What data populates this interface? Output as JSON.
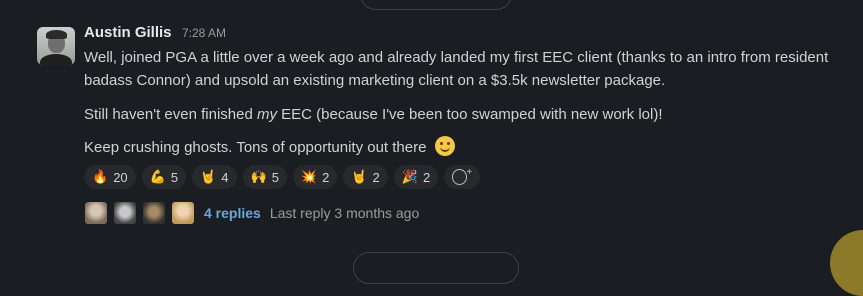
{
  "message": {
    "author": "Austin Gillis",
    "timestamp": "7:28 AM",
    "paragraphs": {
      "p1": "Well, joined PGA a little over a week ago and already landed my first EEC client (thanks to an intro from resident badass Connor) and upsold an existing marketing client on a $3.5k newsletter package.",
      "p2_before": "Still haven't even finished ",
      "p2_em": "my",
      "p2_after": " EEC (because I've been too swamped with new work lol)!",
      "p3": "Keep crushing ghosts. Tons of opportunity out there"
    },
    "inline_emoji": "slightly-smiling-face"
  },
  "reactions": [
    {
      "emoji": "🔥",
      "icon": "fire-emoji-icon",
      "count": "20"
    },
    {
      "emoji": "💪",
      "icon": "flexed-biceps-emoji-icon",
      "count": "5"
    },
    {
      "emoji": "🤘",
      "icon": "rock-on-emoji-icon",
      "count": "4"
    },
    {
      "emoji": "🙌",
      "icon": "raising-hands-emoji-icon",
      "count": "5"
    },
    {
      "emoji": "💥",
      "icon": "collision-emoji-icon",
      "count": "2"
    },
    {
      "emoji": "🤘",
      "icon": "rock-on-emoji-icon",
      "count": "2"
    },
    {
      "emoji": "🎉",
      "icon": "party-popper-emoji-icon",
      "count": "2"
    }
  ],
  "add_reaction_icon": "add-reaction-icon",
  "thread": {
    "replies_label": "4 replies",
    "last_reply": "Last reply 3 months ago"
  }
}
